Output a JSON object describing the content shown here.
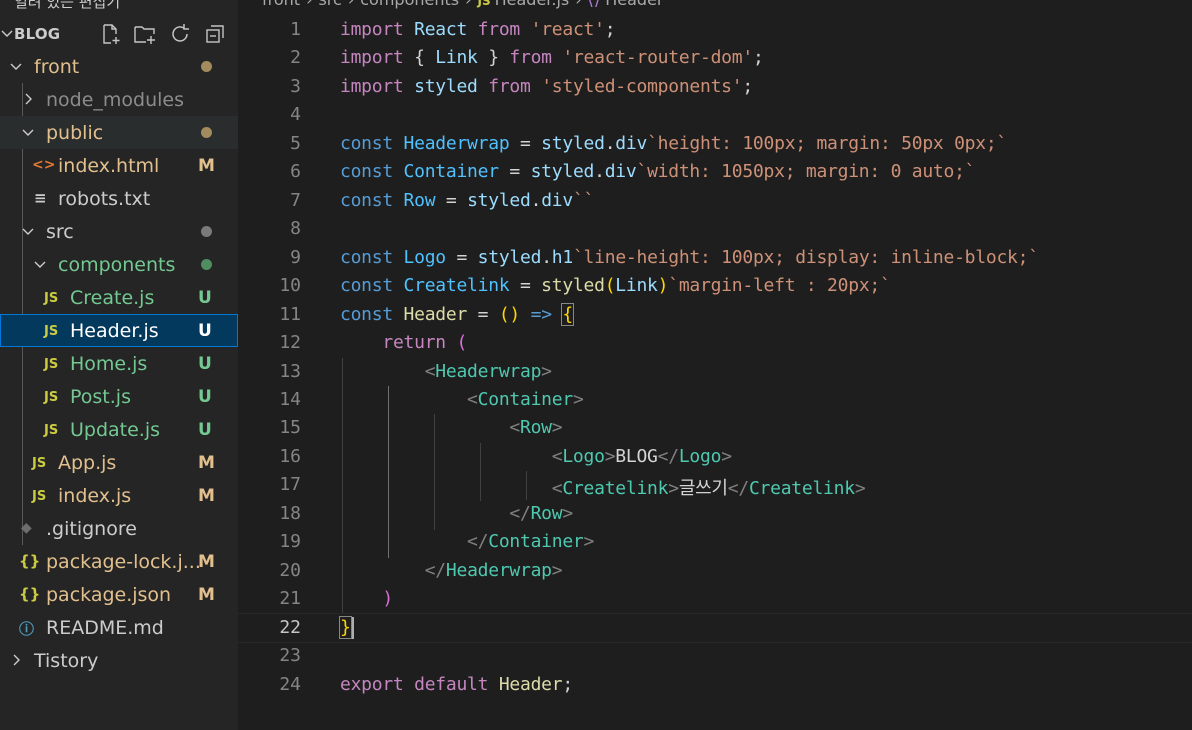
{
  "sidebar": {
    "open_editors_label": "열려 있는 편집기",
    "root_label": "BLOG",
    "items": [
      {
        "label": "front",
        "status": "dot"
      },
      {
        "label": "node_modules",
        "status": ""
      },
      {
        "label": "public",
        "status": "dot"
      },
      {
        "label": "index.html",
        "status": "M",
        "icon": "<>"
      },
      {
        "label": "robots.txt",
        "status": "",
        "icon": "≡"
      },
      {
        "label": "src",
        "status": "dot"
      },
      {
        "label": "components",
        "status": "dot"
      },
      {
        "label": "Create.js",
        "status": "U",
        "icon": "JS"
      },
      {
        "label": "Header.js",
        "status": "U",
        "icon": "JS"
      },
      {
        "label": "Home.js",
        "status": "U",
        "icon": "JS"
      },
      {
        "label": "Post.js",
        "status": "U",
        "icon": "JS"
      },
      {
        "label": "Update.js",
        "status": "U",
        "icon": "JS"
      },
      {
        "label": "App.js",
        "status": "M",
        "icon": "JS"
      },
      {
        "label": "index.js",
        "status": "M",
        "icon": "JS"
      },
      {
        "label": ".gitignore",
        "status": "",
        "icon": "◆"
      },
      {
        "label": "package-lock.j...",
        "status": "M",
        "icon": "{}"
      },
      {
        "label": "package.json",
        "status": "M",
        "icon": "{}"
      },
      {
        "label": "README.md",
        "status": "",
        "icon": "ⓘ"
      },
      {
        "label": "Tistory",
        "status": ""
      }
    ]
  },
  "breadcrumb": {
    "parts": [
      "front",
      "src",
      "components"
    ],
    "file_icon": "JS",
    "file": "Header.js",
    "symbol_icon": "⟨⟩",
    "symbol": "Header"
  },
  "editor": {
    "line_numbers": [
      "1",
      "2",
      "3",
      "4",
      "5",
      "6",
      "7",
      "8",
      "9",
      "10",
      "11",
      "12",
      "13",
      "14",
      "15",
      "16",
      "17",
      "18",
      "19",
      "20",
      "21",
      "22",
      "23",
      "24"
    ],
    "tokens": {
      "import": "import",
      "from": "from",
      "const": "const",
      "return": "return",
      "export": "export",
      "default": "default",
      "React": "React",
      "Link": "Link",
      "styled": "styled",
      "str_react": "'react'",
      "str_router": "'react-router-dom'",
      "str_styled": "'styled-components'",
      "Headerwrap": "Headerwrap",
      "Container": "Container",
      "Row": "Row",
      "Logo": "Logo",
      "Createlink": "Createlink",
      "Header": "Header",
      "div": "div",
      "h1": "h1",
      "tpl_headerwrap": "`height: 100px; margin: 50px 0px;`",
      "tpl_container": "`width: 1050px; margin: 0 auto;`",
      "tpl_row": "``",
      "tpl_logo": "`line-height: 100px; display: inline-block;`",
      "tpl_createlink": "`margin-left : 20px;`",
      "blog_text": "BLOG",
      "write_text": "글쓰기"
    }
  }
}
